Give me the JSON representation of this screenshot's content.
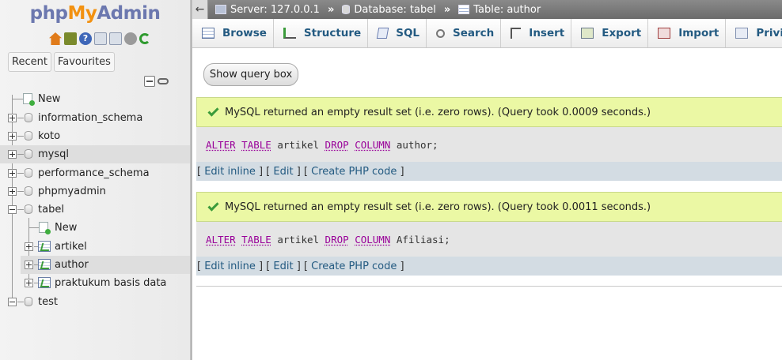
{
  "logo": {
    "php": "php",
    "my": "My",
    "admin": "Admin"
  },
  "nav": {
    "tabs": [
      "Recent",
      "Favourites"
    ],
    "tree": [
      {
        "label": "New"
      },
      {
        "label": "information_schema"
      },
      {
        "label": "koto"
      },
      {
        "label": "mysql"
      },
      {
        "label": "performance_schema"
      },
      {
        "label": "phpmyadmin"
      },
      {
        "label": "tabel"
      },
      {
        "label": "New"
      },
      {
        "label": "artikel"
      },
      {
        "label": "author"
      },
      {
        "label": "praktukum basis data"
      },
      {
        "label": "test"
      }
    ]
  },
  "breadcrumb": {
    "server": "Server: 127.0.0.1",
    "database": "Database: tabel",
    "table": "Table: author",
    "separator": "»",
    "back": "←"
  },
  "tabs": [
    "Browse",
    "Structure",
    "SQL",
    "Search",
    "Insert",
    "Export",
    "Import",
    "Privileges"
  ],
  "main": {
    "show_query_box": "Show query box",
    "results": [
      {
        "message": "MySQL returned an empty result set (i.e. zero rows). (Query took 0.0009 seconds.)",
        "sql": {
          "kw1": "ALTER",
          "kw2": "TABLE",
          "t1": " artikel ",
          "kw3": "DROP",
          "kw4": "COLUMN",
          "t2": " author;"
        }
      },
      {
        "message": "MySQL returned an empty result set (i.e. zero rows). (Query took 0.0011 seconds.)",
        "sql": {
          "kw1": "ALTER",
          "kw2": "TABLE",
          "t1": " artikel ",
          "kw3": "DROP",
          "kw4": "COLUMN",
          "t2": " Afiliasi;"
        }
      }
    ],
    "tools": {
      "open": "[ ",
      "edit_inline": "Edit inline",
      "mid1": " ] [ ",
      "edit": "Edit",
      "mid2": " ] [ ",
      "create_php": "Create PHP code",
      "close": " ]"
    }
  }
}
